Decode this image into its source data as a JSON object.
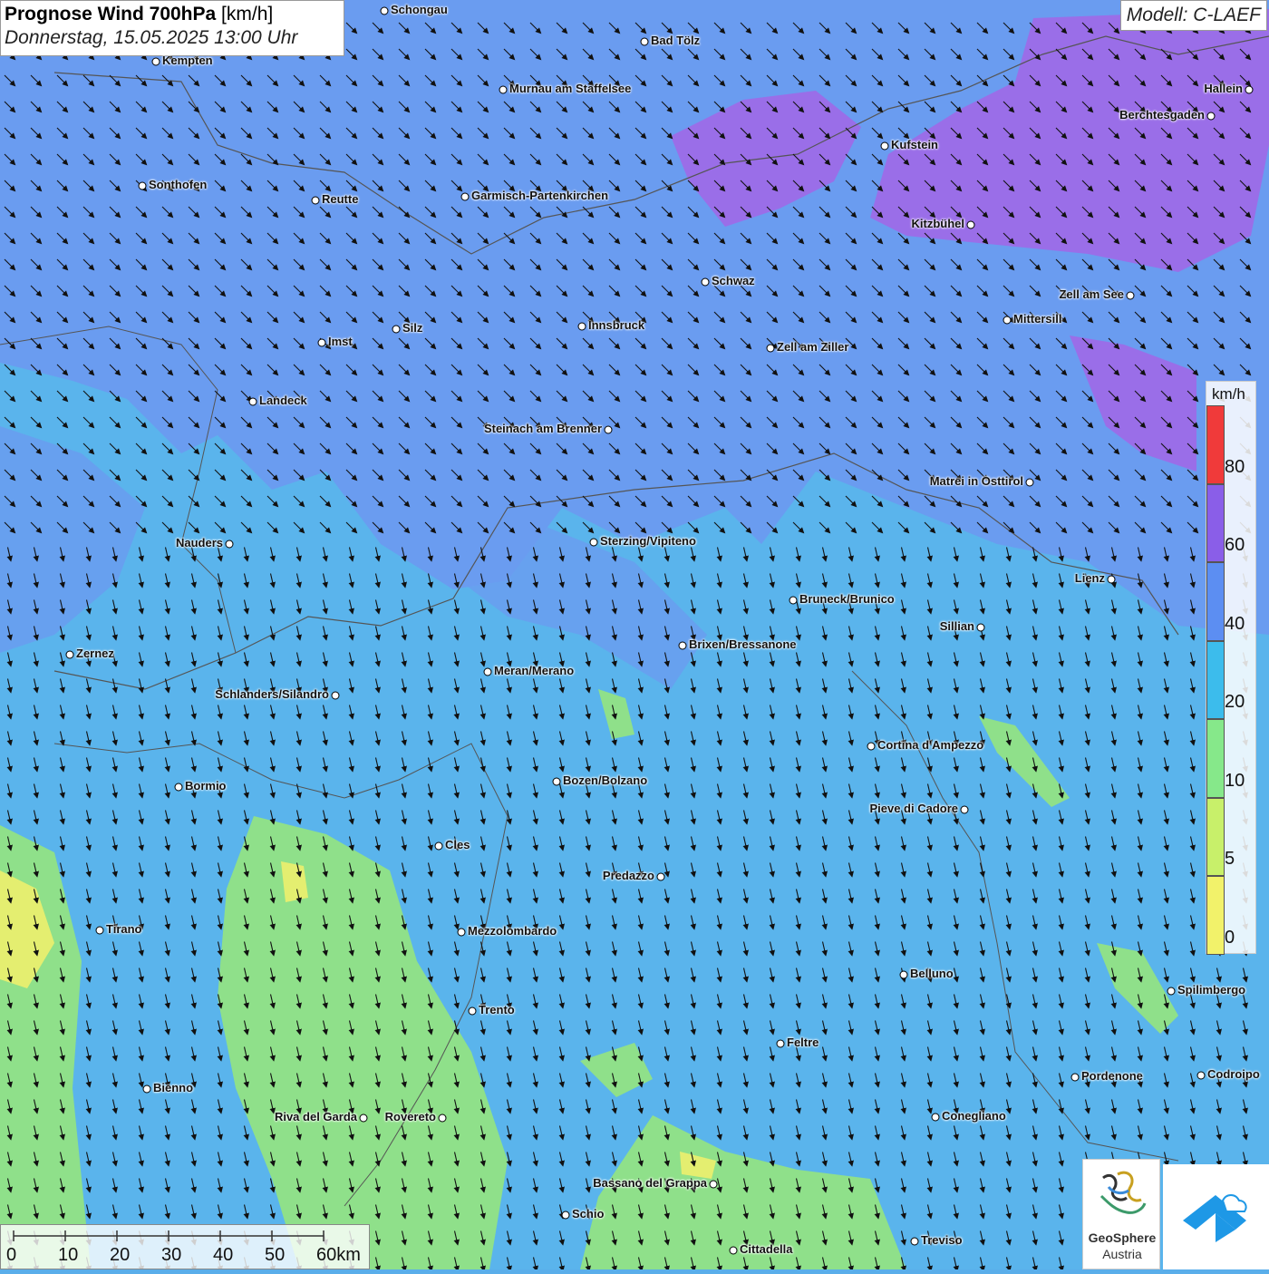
{
  "title": {
    "main": "Prognose Wind 700hPa",
    "unit": "[km/h]",
    "datetime": "Donnerstag, 15.05.2025 13:00 Uhr"
  },
  "model": "Modell: C-LAEF",
  "colors": {
    "sea_lightblue": "#5ab4ec",
    "band_blue": "#6a9cf0",
    "band_purple": "#9a6ee8",
    "band_green": "#8fe08a",
    "band_yellow": "#e4ee70",
    "arrow": "#111111"
  },
  "cities": [
    {
      "name": "Schongau",
      "side": "right"
    },
    {
      "name": "Bad Tölz",
      "side": "right"
    },
    {
      "name": "Kempten",
      "side": "right"
    },
    {
      "name": "Murnau am Staffelsee",
      "side": "right"
    },
    {
      "name": "Hallein",
      "side": "left"
    },
    {
      "name": "Berchtesgaden",
      "side": "left"
    },
    {
      "name": "Kufstein",
      "side": "right"
    },
    {
      "name": "Sonthofen",
      "side": "right"
    },
    {
      "name": "Reutte",
      "side": "right"
    },
    {
      "name": "Garmisch-Partenkirchen",
      "side": "right"
    },
    {
      "name": "Kitzbühel",
      "side": "left"
    },
    {
      "name": "Schwaz",
      "side": "right"
    },
    {
      "name": "Zell am See",
      "side": "left"
    },
    {
      "name": "Mittersill",
      "side": "right"
    },
    {
      "name": "Innsbruck",
      "side": "right"
    },
    {
      "name": "Silz",
      "side": "right"
    },
    {
      "name": "Imst",
      "side": "right"
    },
    {
      "name": "Zell am Ziller",
      "side": "right"
    },
    {
      "name": "Landeck",
      "side": "right"
    },
    {
      "name": "Steinach am Brenner",
      "side": "left"
    },
    {
      "name": "Matrei in Osttirol",
      "side": "left"
    },
    {
      "name": "Nauders",
      "side": "left"
    },
    {
      "name": "Sterzing/Vipiteno",
      "side": "right"
    },
    {
      "name": "Lienz",
      "side": "left"
    },
    {
      "name": "Bruneck/Brunico",
      "side": "right"
    },
    {
      "name": "Sillian",
      "side": "left"
    },
    {
      "name": "Zernez",
      "side": "right"
    },
    {
      "name": "Brixen/Bressanone",
      "side": "right"
    },
    {
      "name": "Meran/Merano",
      "side": "right"
    },
    {
      "name": "Schlanders/Silandro",
      "side": "left"
    },
    {
      "name": "Cortina d'Ampezzo",
      "side": "right"
    },
    {
      "name": "Bozen/Bolzano",
      "side": "right"
    },
    {
      "name": "Bormio",
      "side": "right"
    },
    {
      "name": "Pieve di Cadore",
      "side": "left"
    },
    {
      "name": "Cles",
      "side": "right"
    },
    {
      "name": "Predazzo",
      "side": "left"
    },
    {
      "name": "Tirano",
      "side": "right"
    },
    {
      "name": "Mezzolombardo",
      "side": "right"
    },
    {
      "name": "Belluno",
      "side": "right"
    },
    {
      "name": "Spilimbergo",
      "side": "right"
    },
    {
      "name": "Trento",
      "side": "right"
    },
    {
      "name": "Feltre",
      "side": "right"
    },
    {
      "name": "Bienno",
      "side": "right"
    },
    {
      "name": "Pordenone",
      "side": "right"
    },
    {
      "name": "Codroipo",
      "side": "right"
    },
    {
      "name": "Riva del Garda",
      "side": "left"
    },
    {
      "name": "Rovereto",
      "side": "left"
    },
    {
      "name": "Conegliano",
      "side": "right"
    },
    {
      "name": "Bassano del Grappa",
      "side": "left"
    },
    {
      "name": "Schio",
      "side": "right"
    },
    {
      "name": "Treviso",
      "side": "right"
    },
    {
      "name": "Cittadella",
      "side": "right"
    }
  ],
  "legend": {
    "unit": "km/h",
    "ticks": [
      "80",
      "60",
      "40",
      "20",
      "10",
      "5",
      "0"
    ],
    "segments": [
      {
        "color": "#f03a3a",
        "from": 80
      },
      {
        "color": "#8a5ee8",
        "from": 60
      },
      {
        "color": "#5c8ef2",
        "from": 40
      },
      {
        "color": "#3cbcec",
        "from": 20
      },
      {
        "color": "#86e88a",
        "from": 10
      },
      {
        "color": "#c8f06a",
        "from": 5
      },
      {
        "color": "#f2f26a",
        "from": 0
      }
    ]
  },
  "scalebar": {
    "labels": [
      "0",
      "10",
      "20",
      "30",
      "40",
      "50",
      "60km"
    ]
  },
  "logos": {
    "geosphere_line1": "GeoSphere",
    "geosphere_line2": "Austria"
  }
}
